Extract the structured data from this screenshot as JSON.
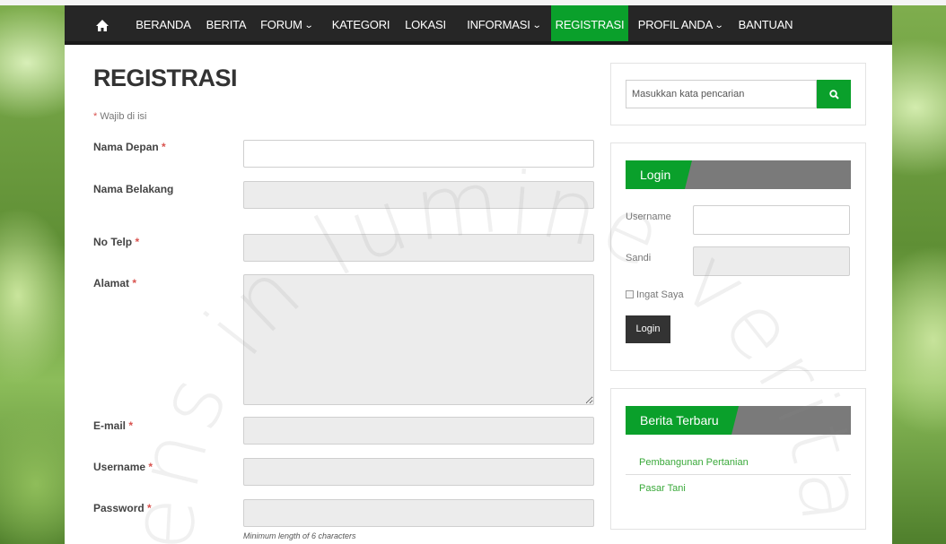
{
  "nav": {
    "home_icon": "home-icon",
    "items": [
      {
        "label": "BERANDA",
        "dropdown": false,
        "active": false
      },
      {
        "label": "BERITA",
        "dropdown": false,
        "active": false
      },
      {
        "label": "FORUM",
        "dropdown": true,
        "active": false
      },
      {
        "label": "KATEGORI",
        "dropdown": false,
        "active": false
      },
      {
        "label": "LOKASI",
        "dropdown": false,
        "active": false
      },
      {
        "label": "INFORMASI",
        "dropdown": true,
        "active": false
      },
      {
        "label": "REGISTRASI",
        "dropdown": false,
        "active": true
      },
      {
        "label": "PROFIL ANDA",
        "dropdown": true,
        "active": false
      },
      {
        "label": "BANTUAN",
        "dropdown": false,
        "active": false
      }
    ],
    "caret_icon": "chevron-down-icon"
  },
  "form": {
    "title": "REGISTRASI",
    "required_note": "Wajib di isi",
    "required_marker": "*",
    "fields": [
      {
        "label": "Nama Depan",
        "required": true,
        "value": ""
      },
      {
        "label": "Nama Belakang",
        "required": false,
        "value": ""
      },
      {
        "label": "No Telp",
        "required": true,
        "value": ""
      },
      {
        "label": "Alamat",
        "required": true,
        "value": ""
      },
      {
        "label": "E-mail",
        "required": true,
        "value": ""
      },
      {
        "label": "Username",
        "required": true,
        "value": ""
      },
      {
        "label": "Password",
        "required": true,
        "value": ""
      }
    ],
    "password_hint": "Minimum length of 6 characters"
  },
  "sidebar": {
    "search": {
      "placeholder": "Masukkan kata pencarian",
      "icon": "search-icon"
    },
    "login": {
      "title": "Login",
      "username_label": "Username",
      "password_label": "Sandi",
      "remember_label": "Ingat Saya",
      "button_label": "Login"
    },
    "news": {
      "title": "Berita Terbaru",
      "items": [
        "Pembangunan Pertanian",
        "Pasar Tani"
      ]
    }
  },
  "watermark": {
    "text": "lens in lumine veritas"
  },
  "colors": {
    "accent": "#0aa02b",
    "navbar": "#262626",
    "required": "#d9534f",
    "link": "#3aa93a"
  }
}
